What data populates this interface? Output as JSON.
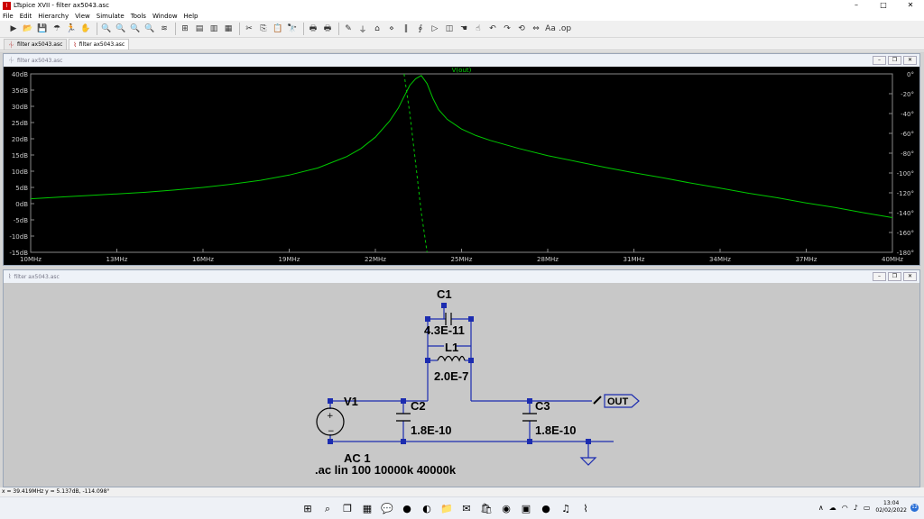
{
  "window": {
    "title": "LTspice XVII - filter ax5043.asc",
    "icon": "ltspice-app-icon",
    "min": "–",
    "max": "□",
    "close": "✕"
  },
  "menu": [
    "File",
    "Edit",
    "Hierarchy",
    "View",
    "Simulate",
    "Tools",
    "Window",
    "Help"
  ],
  "toolbar_icons": [
    "run-icon",
    "open-icon",
    "save-icon",
    "control-panel-icon",
    "halt-icon",
    "pan-icon",
    "zoom-in-icon",
    "zoom-out-icon",
    "zoom-fit-icon",
    "zoom-cancel-icon",
    "autorange-icon",
    "grid-icon",
    "tile-horizontal-icon",
    "cascade-icon",
    "tile-vertical-icon",
    "cut-icon",
    "copy-icon",
    "paste-icon",
    "find-icon",
    "print-icon",
    "print-preview-icon",
    "wire-icon",
    "ground-icon",
    "label-icon",
    "resistor-icon",
    "capacitor-icon",
    "inductor-icon",
    "diode-icon",
    "component-icon",
    "move-icon",
    "drag-icon",
    "undo-icon",
    "redo-icon",
    "rotate-icon",
    "mirror-icon",
    "text-icon",
    "spice-directive-icon"
  ],
  "toolbar_glyphs": [
    "▶",
    "📂",
    "💾",
    "☂",
    "🏃",
    "✋",
    "🔍",
    "🔍",
    "🔍",
    "🔍",
    "≋",
    "⊞",
    "▤",
    "▥",
    "▦",
    "✂",
    "⎘",
    "📋",
    "🔭",
    "🖶",
    "🖶",
    "✎",
    "⏚",
    "⌂",
    "⋄",
    "‖",
    "∮",
    "▷",
    "◫",
    "☚",
    "☝",
    "↶",
    "↷",
    "⟲",
    "⇔",
    "Aa",
    ".op"
  ],
  "tabs": [
    {
      "label": "filter ax5043.asc",
      "icon": "waveform-icon"
    },
    {
      "label": "filter ax5043.asc",
      "icon": "schematic-icon"
    }
  ],
  "plot_window": {
    "title": "filter ax5043.asc",
    "trace": "V(out)"
  },
  "schematic_window": {
    "title": "filter ax5043.asc"
  },
  "chart_data": {
    "type": "line",
    "title": "V(out)",
    "x": {
      "ticks": [
        "10MHz",
        "13MHz",
        "16MHz",
        "19MHz",
        "22MHz",
        "25MHz",
        "28MHz",
        "31MHz",
        "34MHz",
        "37MHz",
        "40MHz"
      ],
      "range": [
        10,
        40
      ],
      "unit": "MHz"
    },
    "y_left": {
      "ticks": [
        "40dB",
        "35dB",
        "30dB",
        "25dB",
        "20dB",
        "15dB",
        "10dB",
        "5dB",
        "0dB",
        "-5dB",
        "-10dB",
        "-15dB"
      ],
      "range": [
        -15,
        40
      ]
    },
    "y_right": {
      "ticks": [
        "0°",
        "-20°",
        "-40°",
        "-60°",
        "-80°",
        "-100°",
        "-120°",
        "-140°",
        "-160°",
        "-180°"
      ],
      "range": [
        -180,
        0
      ]
    },
    "series": [
      {
        "name": "V(out)",
        "kind": "magnitude",
        "color": "#00c800",
        "x": [
          10,
          11,
          12,
          13,
          14,
          15,
          16,
          17,
          18,
          19,
          20,
          21,
          21.5,
          22,
          22.5,
          22.8,
          23,
          23.2,
          23.4,
          23.6,
          23.8,
          24,
          24.2,
          24.5,
          25,
          25.5,
          26,
          27,
          28,
          29,
          30,
          31,
          32,
          33,
          34,
          35,
          36,
          37,
          38,
          39,
          40
        ],
        "y": [
          1.5,
          2.0,
          2.5,
          3.0,
          3.5,
          4.2,
          5.0,
          6.0,
          7.2,
          8.8,
          11.0,
          14.5,
          17.0,
          20.5,
          25.5,
          29.5,
          33.0,
          36.5,
          38.5,
          39.5,
          37.0,
          32.5,
          29.0,
          26.0,
          23.0,
          21.0,
          19.5,
          17.0,
          14.8,
          13.0,
          11.2,
          9.5,
          8.0,
          6.3,
          4.8,
          3.2,
          1.8,
          0.2,
          -1.2,
          -2.8,
          -4.3
        ]
      },
      {
        "name": "phase",
        "kind": "phase",
        "color": "#00c800",
        "x": [
          23.0,
          23.2,
          23.4,
          23.6,
          23.8
        ],
        "y": [
          0,
          -40,
          -90,
          -140,
          -180
        ]
      }
    ]
  },
  "schematic": {
    "C1": {
      "name": "C1",
      "value": "4.3E-11"
    },
    "L1": {
      "name": "L1",
      "value": "2.0E-7"
    },
    "C2": {
      "name": "C2",
      "value": "1.8E-10"
    },
    "C3": {
      "name": "C3",
      "value": "1.8E-10"
    },
    "V1": {
      "name": "V1",
      "value": "AC 1"
    },
    "directive": ".ac lin 100 10000k 40000k",
    "out_label": "OUT"
  },
  "status": "x = 39.419MHz    y = 5.137dB, -114.098°",
  "taskbar": {
    "icons": [
      "windows-start-icon",
      "search-icon",
      "task-view-icon",
      "widgets-icon",
      "chat-icon",
      "whatsapp-icon",
      "edge-icon",
      "file-explorer-icon",
      "mail-icon",
      "store-icon",
      "chrome-icon",
      "terminal-icon",
      "spotify-icon",
      "podcast-icon",
      "ltspice-taskbar-icon"
    ],
    "glyphs": [
      "⊞",
      "⌕",
      "❐",
      "▦",
      "💬",
      "●",
      "◐",
      "📁",
      "✉",
      "🛍",
      "◉",
      "▣",
      "●",
      "♫",
      "⌇"
    ],
    "time": "13:04",
    "date": "02/02/2022",
    "badge": "12"
  }
}
